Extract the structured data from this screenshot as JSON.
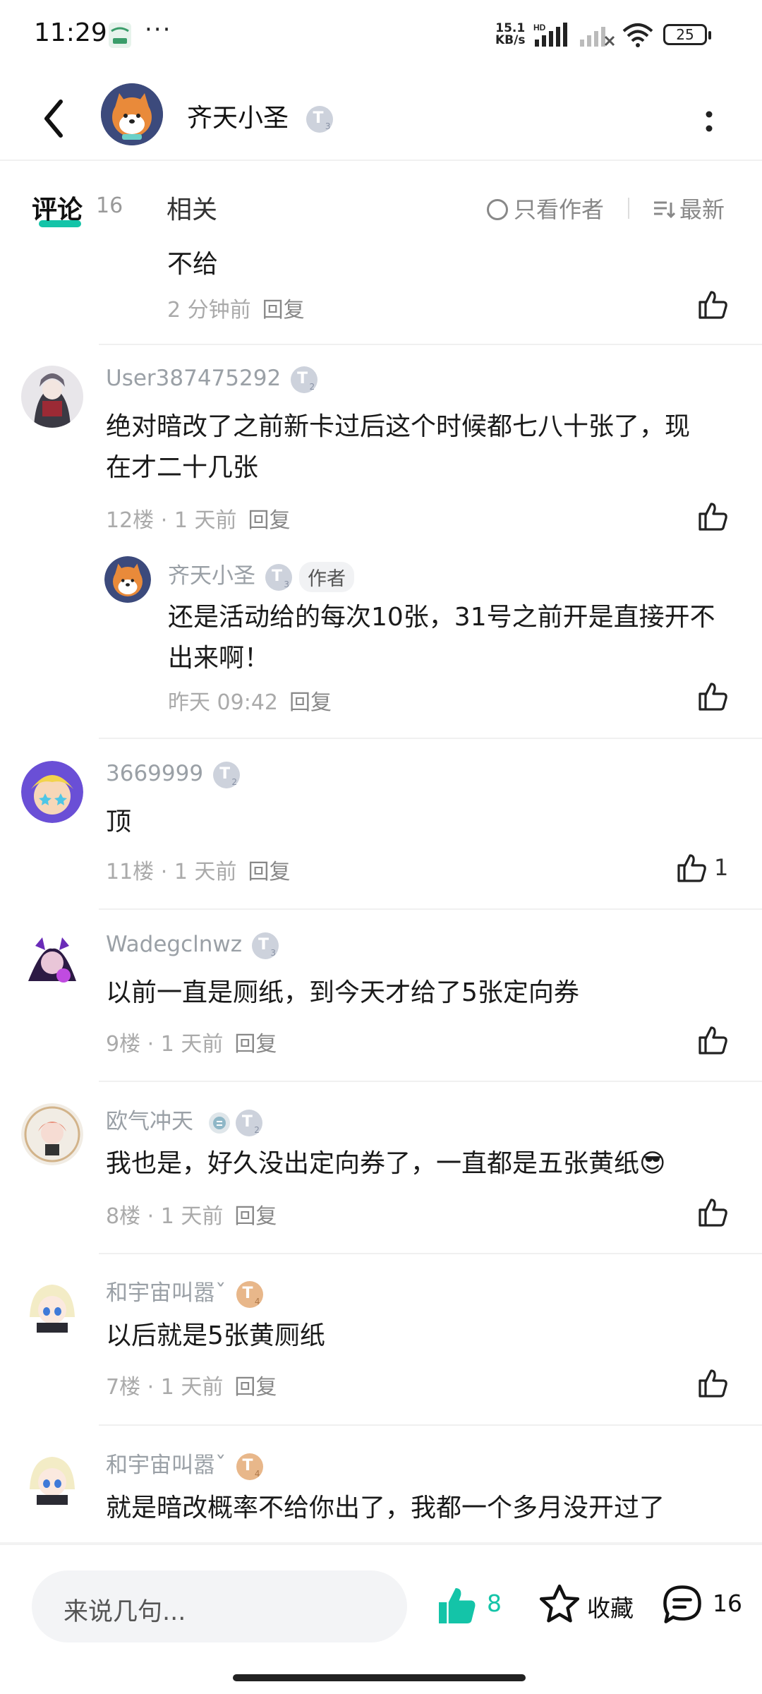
{
  "status_bar": {
    "time": "11:29",
    "dots": "···",
    "net_speed_value": "15.1",
    "net_speed_unit": "KB/s",
    "hd": "HD",
    "battery": "25"
  },
  "header": {
    "title": "齐天小圣",
    "badge_t": "T",
    "badge_level": "3"
  },
  "tabs": {
    "comments_label": "评论",
    "comments_count": "16",
    "related_label": "相关",
    "only_author_label": "只看作者",
    "sort_label": "最新"
  },
  "comments": [
    {
      "text": "不给",
      "meta_time": "2 分钟前",
      "reply_label": "回复"
    },
    {
      "name": "User387475292",
      "badge_level": "2",
      "text": "绝对暗改了之前新卡过后这个时候都七八十张了，现在才二十几张",
      "floor": "12楼",
      "sep": "·",
      "time": "1 天前",
      "reply_label": "回复"
    },
    {
      "name": "齐天小圣",
      "badge_level": "3",
      "author_tag": "作者",
      "text": "还是活动给的每次10张，31号之前开是直接开不出来啊！",
      "time": "昨天 09:42",
      "reply_label": "回复"
    },
    {
      "name": "3669999",
      "badge_level": "2",
      "text": "顶",
      "floor": "11楼",
      "sep": "·",
      "time": "1 天前",
      "reply_label": "回复",
      "likes": "1"
    },
    {
      "name": "Wadegclnwz",
      "badge_level": "3",
      "text": "以前一直是厕纸，到今天才给了5张定向券",
      "floor": "9楼",
      "sep": "·",
      "time": "1 天前",
      "reply_label": "回复"
    },
    {
      "name": "欧气冲天",
      "badge_level": "2",
      "text": "我也是，好久没出定向券了，一直都是五张黄纸😎",
      "floor": "8楼",
      "sep": "·",
      "time": "1 天前",
      "reply_label": "回复"
    },
    {
      "name": "和宇宙叫嚣ˇ",
      "badge_level": "4",
      "text": "以后就是5张黄厕纸",
      "floor": "7楼",
      "sep": "·",
      "time": "1 天前",
      "reply_label": "回复"
    },
    {
      "name": "和宇宙叫嚣ˇ",
      "badge_level": "4",
      "text": "就是暗改概率不给你出了，我都一个多月没开过了"
    }
  ],
  "bottom_bar": {
    "input_placeholder": "来说几句...",
    "like_count": "8",
    "favorite_label": "收藏",
    "comment_count": "16"
  },
  "colors": {
    "accent": "#14c4a8",
    "muted_text": "#9aa0a6",
    "divider": "#f0f0f0"
  }
}
